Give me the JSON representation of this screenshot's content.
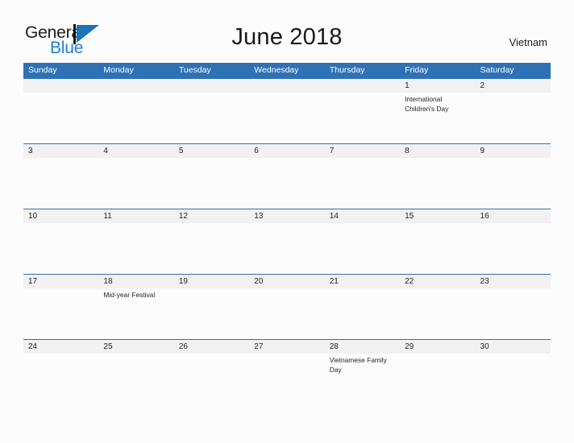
{
  "header": {
    "logo": {
      "word_one": "General",
      "word_two": "Blue",
      "mark": "flag-triangle-icon"
    },
    "title": "June 2018",
    "country": "Vietnam"
  },
  "colors": {
    "header_blue": "#2e71b5",
    "band_gray": "#f1f1f1",
    "logo_blue": "#1f7fd0",
    "page_background": "#fcfcfd",
    "text": "#1f1f1f"
  },
  "calendar": {
    "month": "June",
    "year": "2018",
    "weekday_headers": [
      "Sunday",
      "Monday",
      "Tuesday",
      "Wednesday",
      "Thursday",
      "Friday",
      "Saturday"
    ],
    "weeks": [
      [
        {
          "date": "",
          "event": ""
        },
        {
          "date": "",
          "event": ""
        },
        {
          "date": "",
          "event": ""
        },
        {
          "date": "",
          "event": ""
        },
        {
          "date": "",
          "event": ""
        },
        {
          "date": "1",
          "event": "International Children's Day"
        },
        {
          "date": "2",
          "event": ""
        }
      ],
      [
        {
          "date": "3",
          "event": ""
        },
        {
          "date": "4",
          "event": ""
        },
        {
          "date": "5",
          "event": ""
        },
        {
          "date": "6",
          "event": ""
        },
        {
          "date": "7",
          "event": ""
        },
        {
          "date": "8",
          "event": ""
        },
        {
          "date": "9",
          "event": ""
        }
      ],
      [
        {
          "date": "10",
          "event": ""
        },
        {
          "date": "11",
          "event": ""
        },
        {
          "date": "12",
          "event": ""
        },
        {
          "date": "13",
          "event": ""
        },
        {
          "date": "14",
          "event": ""
        },
        {
          "date": "15",
          "event": ""
        },
        {
          "date": "16",
          "event": ""
        }
      ],
      [
        {
          "date": "17",
          "event": ""
        },
        {
          "date": "18",
          "event": "Mid-year Festival"
        },
        {
          "date": "19",
          "event": ""
        },
        {
          "date": "20",
          "event": ""
        },
        {
          "date": "21",
          "event": ""
        },
        {
          "date": "22",
          "event": ""
        },
        {
          "date": "23",
          "event": ""
        }
      ],
      [
        {
          "date": "24",
          "event": ""
        },
        {
          "date": "25",
          "event": ""
        },
        {
          "date": "26",
          "event": ""
        },
        {
          "date": "27",
          "event": ""
        },
        {
          "date": "28",
          "event": "Vietnamese Family Day"
        },
        {
          "date": "29",
          "event": ""
        },
        {
          "date": "30",
          "event": ""
        }
      ]
    ]
  }
}
